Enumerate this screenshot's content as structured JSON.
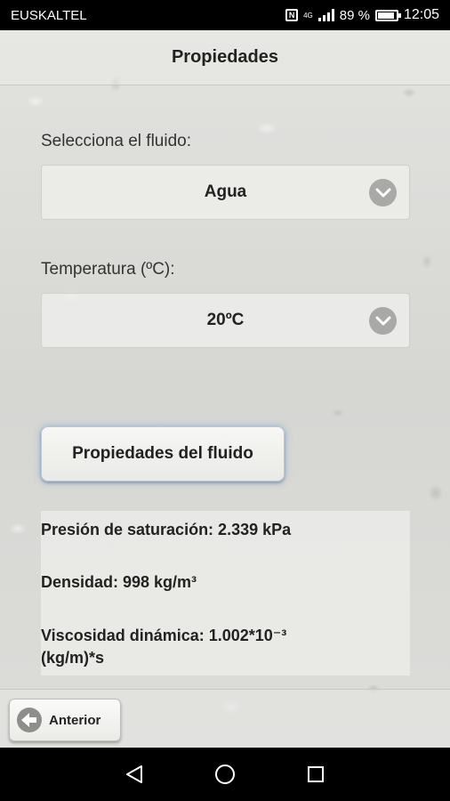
{
  "status_bar": {
    "carrier": "EUSKALTEL",
    "network": "4G",
    "battery_percent_text": "89 %",
    "battery_level": 0.89,
    "time": "12:05",
    "icons": [
      "nfc-icon",
      "signal-icon",
      "battery-icon"
    ]
  },
  "header": {
    "title": "Propiedades"
  },
  "form": {
    "fluid_label": "Selecciona el fluido:",
    "fluid_value": "Agua",
    "temperature_label": "Temperatura (ºC):",
    "temperature_value": "20ºC",
    "submit_label": "Propiedades del fluido"
  },
  "results": {
    "saturation_pressure": "Presión de saturación: 2.339 kPa",
    "density": "Densidad: 998 kg/m³",
    "dynamic_viscosity_line1": "Viscosidad dinámica: 1.002*10⁻³",
    "dynamic_viscosity_line2": "(kg/m)*s"
  },
  "footer": {
    "back_label": "Anterior"
  },
  "nav_bar": {
    "icons": [
      "back-triangle-icon",
      "home-circle-icon",
      "recents-square-icon"
    ]
  },
  "colors": {
    "chevron_bg": "#a9a9a7",
    "button_glow": "#5a96dc"
  }
}
